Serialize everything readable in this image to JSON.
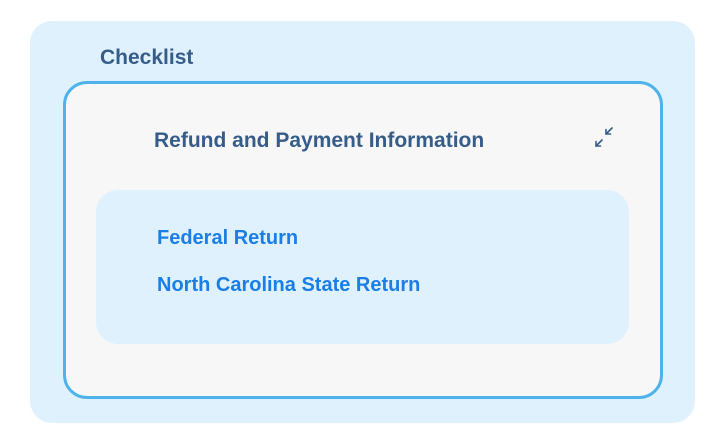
{
  "checklist": {
    "title": "Checklist",
    "section": {
      "title": "Refund and Payment Information",
      "collapse_icon": "collapse-arrows-icon",
      "links": [
        {
          "label": "Federal Return"
        },
        {
          "label": "North Carolina State Return"
        }
      ]
    }
  },
  "colors": {
    "panel_background": "#dff1fc",
    "card_background": "#f7f7f7",
    "card_border": "#4db3ea",
    "heading": "#365c8a",
    "link": "#1a7ee6"
  }
}
